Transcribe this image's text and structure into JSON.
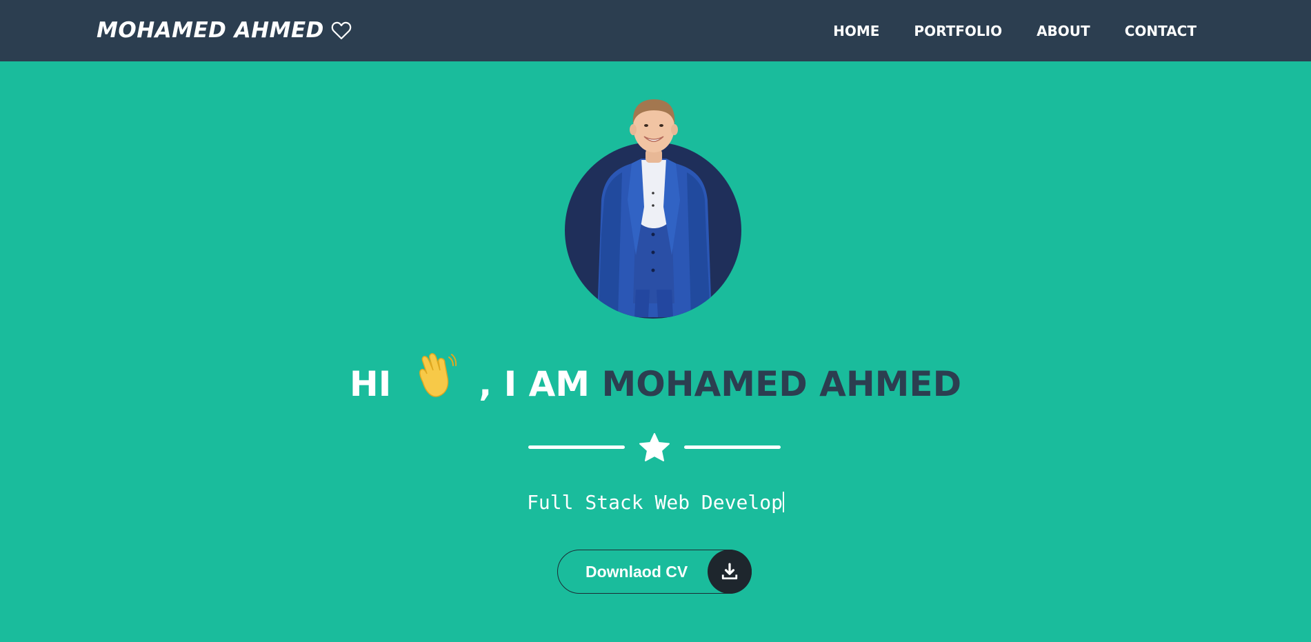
{
  "colors": {
    "background": "#1abc9c",
    "navbar": "#2c3e50",
    "accent_text": "#2c3e50",
    "button_icon_bg": "#1e262d",
    "white": "#ffffff"
  },
  "header": {
    "brand": "MOHAMED AHMED",
    "brand_icon": "heart-outline-icon",
    "nav": [
      {
        "label": "HOME"
      },
      {
        "label": "PORTFOLIO"
      },
      {
        "label": "ABOUT"
      },
      {
        "label": "CONTACT"
      }
    ]
  },
  "hero": {
    "greeting": "HI",
    "wave_icon": "waving-hand-icon",
    "intro": ", I AM",
    "name": "MOHAMED AHMED",
    "divider_icon": "star-icon",
    "subtitle": "Full Stack Web Develop",
    "button_label": "Downlaod CV",
    "button_icon": "download-icon"
  }
}
